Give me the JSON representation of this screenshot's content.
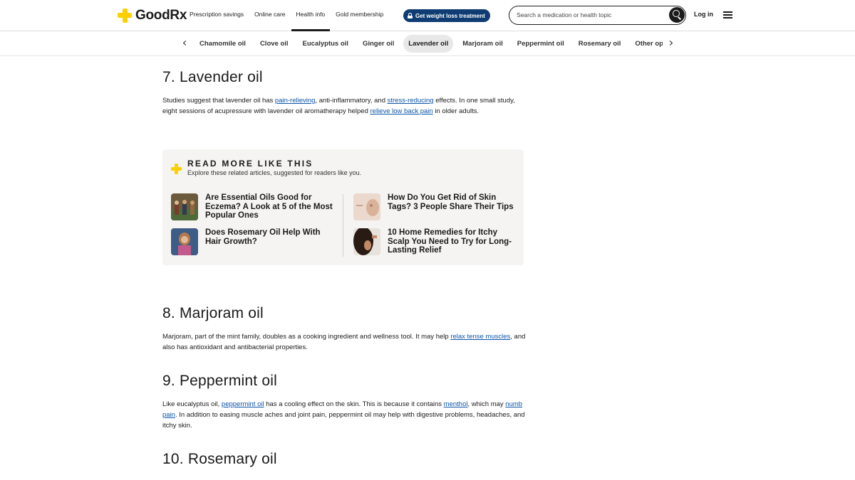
{
  "header": {
    "logo_text": "GoodRx",
    "nav": [
      "Prescription savings",
      "Online care",
      "Health info",
      "Gold membership"
    ],
    "active_nav_index": 2,
    "cta_label": "Get weight loss treatment",
    "search_placeholder": "Search a medication or health topic",
    "login_label": "Log in"
  },
  "topic_tabs": {
    "items": [
      "Chamomile oil",
      "Clove oil",
      "Eucalyptus oil",
      "Ginger oil",
      "Lavender oil",
      "Marjoram oil",
      "Peppermint oil",
      "Rosemary oil",
      "Other options"
    ],
    "active": "Lavender oil"
  },
  "sections": {
    "lavender": {
      "heading": "7. Lavender oil",
      "p1": "Studies suggest that lavender oil has ",
      "link1": "pain-relieving",
      "p2": ", anti-inflammatory, and ",
      "link2": "stress-reducing",
      "p3": " effects. In one small study, eight sessions of acupressure with lavender oil aromatherapy helped ",
      "link3": "relieve low back pain",
      "p4": " in older adults."
    },
    "marjoram": {
      "heading": "8. Marjoram oil",
      "p1": "Marjoram, part of the mint family, doubles as a cooking ingredient and wellness tool. It may help ",
      "link1": "relax tense muscles",
      "p2": ", and also has antioxidant and antibacterial properties."
    },
    "peppermint": {
      "heading": "9. Peppermint oil",
      "p1": "Like eucalyptus oil, ",
      "link1": "peppermint oil",
      "p2": " has a cooling effect on the skin. This is because it contains ",
      "link2": "menthol",
      "p3": ", which may ",
      "link3": "numb pain",
      "p4": ". In addition to easing muscle aches and joint pain, peppermint oil may help with digestive problems, headaches, and itchy skin."
    },
    "rosemary": {
      "heading": "10. Rosemary oil"
    }
  },
  "read_more": {
    "title": "READ MORE LIKE THIS",
    "subtitle": "Explore these related articles, suggested for readers like you.",
    "articles": [
      {
        "title": "Are Essential Oils Good for Eczema? A Look at 5 of the Most Popular Ones"
      },
      {
        "title": "How Do You Get Rid of Skin Tags? 3 People Share Their Tips"
      },
      {
        "title": "Does Rosemary Oil Help With Hair Growth?"
      },
      {
        "title": "10 Home Remedies for Itchy Scalp You Need to Try for Long-Lasting Relief"
      }
    ]
  },
  "colors": {
    "brand_yellow": "#fdd003",
    "cta_navy": "#0f3c72",
    "link_blue": "#0d55a8",
    "box_bg": "#f5f4f2"
  }
}
